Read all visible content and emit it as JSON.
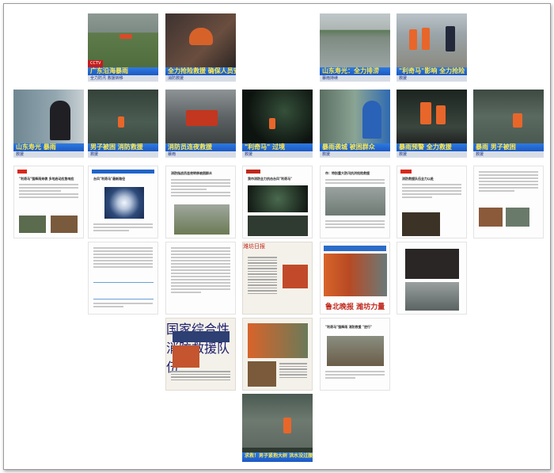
{
  "tiles": {
    "v1": {
      "channel": "CCTV",
      "banner": "广东沿海暴雨",
      "ticker": "全力防汛 救援转移"
    },
    "v2": {
      "banner": "全力抢险救援 确保人员安全",
      "ticker": "消防救援"
    },
    "v3": {
      "banner": "山东寿光：全力排涝",
      "ticker": "暴雨持续"
    },
    "v4": {
      "banner": "\"利奇马\"影响 全力抢险",
      "ticker": "救援"
    },
    "v5": {
      "banner": "山东寿光 暴雨",
      "ticker": "救援"
    },
    "v6": {
      "banner": "男子被困 消防救援",
      "ticker": "救援"
    },
    "v7": {
      "banner": "消防员连夜救援",
      "ticker": "暴雨"
    },
    "v8": {
      "banner": "\"利奇马\" 过境",
      "ticker": "救援"
    },
    "v9": {
      "banner": "暴雨袭城 被困群众",
      "ticker": "救援"
    },
    "v10": {
      "banner": "暴雨预警 全力救援",
      "ticker": "救援"
    },
    "v11": {
      "banner": "暴雨 男子被困",
      "ticker": "救援"
    },
    "v12": {
      "banner": "求救！男子紧抱大树 洪水没过腰部",
      "ticker": ""
    },
    "n1": {
      "headline": "\"利奇马\"强降雨来袭 多地启动应急响应"
    },
    "n2": {
      "headline": "台风\"利奇马\"最新路径"
    },
    "n3": {
      "headline": "消防指战员连夜转移被困群众"
    },
    "n4": {
      "headline": "我市消防全力抗击台风\"利奇马\""
    },
    "n5": {
      "headline": "市：特别重大防汛抗洪抢险救援"
    },
    "n6": {
      "headline": "消防救援队伍全力以赴"
    },
    "n7": {
      "headline": "国家综合性消防救援队伍"
    },
    "n8": {
      "headline": "潍坊日报"
    },
    "n9": {
      "masthead": "鲁北晚报 潍坊力量"
    },
    "n10": {
      "headline": "\"利奇马\"强降雨 消防救援 \"逆行\""
    }
  }
}
